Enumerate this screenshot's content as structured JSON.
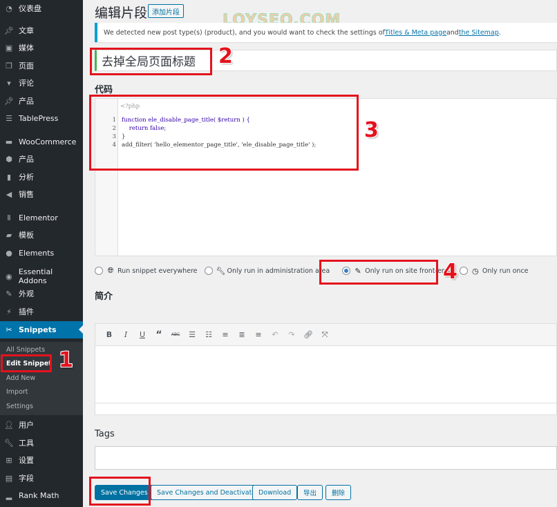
{
  "sidebar": {
    "items": [
      {
        "label": "仪表盘",
        "icon": "dashboard-icon"
      },
      {
        "label": "文章",
        "icon": "pin-icon"
      },
      {
        "label": "媒体",
        "icon": "media-icon"
      },
      {
        "label": "页面",
        "icon": "pages-icon"
      },
      {
        "label": "评论",
        "icon": "comment-icon"
      },
      {
        "label": "产品",
        "icon": "pin-icon"
      },
      {
        "label": "TablePress",
        "icon": "table-icon"
      },
      {
        "label": "WooCommerce",
        "icon": "woo-icon"
      },
      {
        "label": "产品",
        "icon": "box-icon"
      },
      {
        "label": "分析",
        "icon": "chart-icon"
      },
      {
        "label": "销售",
        "icon": "megaphone-icon"
      },
      {
        "label": "Elementor",
        "icon": "elementor-icon"
      },
      {
        "label": "模板",
        "icon": "folder-icon"
      },
      {
        "label": "Elements",
        "icon": "drop-icon"
      },
      {
        "label": "Essential Addons",
        "icon": "ea-icon"
      },
      {
        "label": "外观",
        "icon": "brush-icon"
      },
      {
        "label": "插件",
        "icon": "plugin-icon"
      },
      {
        "label": "Snippets",
        "icon": "scissors-icon",
        "active": true
      },
      {
        "label": "用户",
        "icon": "user-icon"
      },
      {
        "label": "工具",
        "icon": "wrench-icon"
      },
      {
        "label": "设置",
        "icon": "settings-icon"
      },
      {
        "label": "字段",
        "icon": "fields-icon"
      },
      {
        "label": "Rank Math",
        "icon": "rankmath-icon"
      }
    ],
    "submenu": [
      {
        "label": "All Snippets"
      },
      {
        "label": "Edit Snippet",
        "current": true
      },
      {
        "label": "Add New"
      },
      {
        "label": "Import"
      },
      {
        "label": "Settings"
      }
    ]
  },
  "header": {
    "title": "编辑片段",
    "add_new_label": "添加片段"
  },
  "watermark": "LOYSEO.COM",
  "notice": {
    "text_before": "We detected new post type(s) (product), and you would want to check the settings of ",
    "link1": "Titles & Meta page",
    "text_mid": " and ",
    "link2": "the Sitemap",
    "text_after": "."
  },
  "snippet": {
    "title_value": "去掉全局页面标题",
    "code_label": "代码",
    "code_header": "<?php",
    "code_lines": [
      {
        "num": "1",
        "text": "function ele_disable_page_title( $return ) {"
      },
      {
        "num": "2",
        "text": "    return false;"
      },
      {
        "num": "3",
        "text": "}"
      },
      {
        "num": "4",
        "text": "add_filter( 'hello_elementor_page_title', 'ele_disable_page_title' );"
      }
    ],
    "scope_options": [
      {
        "label": "Run snippet everywhere",
        "icon": "globe-icon",
        "checked": false
      },
      {
        "label": "Only run in administration area",
        "icon": "wrench-icon",
        "checked": false
      },
      {
        "label": "Only run on site front-end",
        "icon": "brush-icon",
        "checked": true
      },
      {
        "label": "Only run once",
        "icon": "clock-icon",
        "checked": false
      }
    ],
    "description_label": "简介",
    "description_value": "",
    "toolbar": [
      "bold",
      "italic",
      "underline",
      "blockquote",
      "strikethrough",
      "bullet-list",
      "numbered-list",
      "align-left",
      "align-center",
      "align-right",
      "undo",
      "redo",
      "link",
      "fullscreen"
    ],
    "tags_label": "Tags",
    "tags_value": ""
  },
  "actions": {
    "save": "Save Changes",
    "save_deactivate": "Save Changes and Deactivate",
    "download": "Download",
    "export": "导出",
    "delete": "删除"
  },
  "annotations": [
    "1",
    "2",
    "3",
    "4"
  ]
}
